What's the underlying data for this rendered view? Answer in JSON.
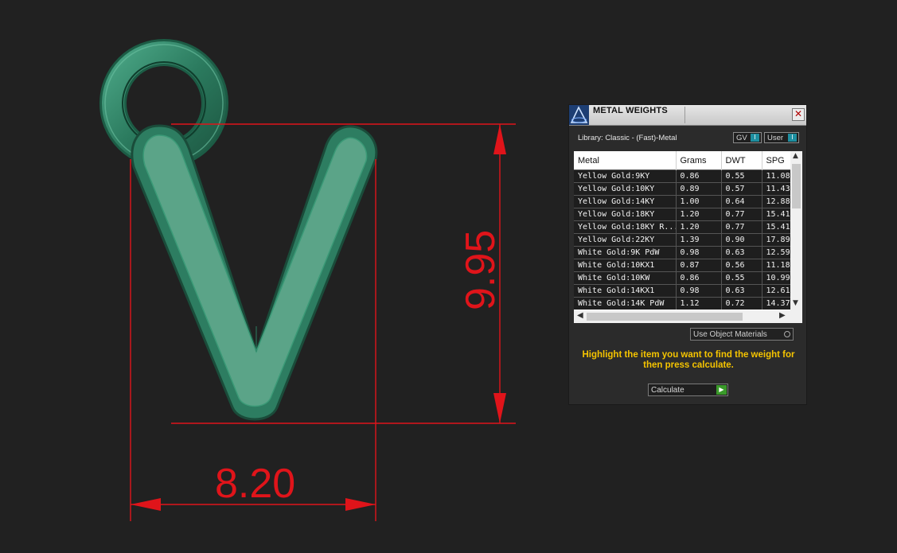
{
  "viewport": {
    "width_dimension": "8.20",
    "height_dimension": "9.95",
    "dimension_color": "#e0141a",
    "model_color": "#4fa083",
    "background": "#212121"
  },
  "panel": {
    "title": "METAL WEIGHTS",
    "close_glyph": "✕",
    "library_label": "Library: Classic - (Fast)-Metal",
    "toggles": {
      "gv": "GV",
      "user": "User",
      "knob": "I"
    },
    "table": {
      "columns": [
        "Metal",
        "Grams",
        "DWT",
        "SPG"
      ],
      "rows": [
        [
          "Yellow Gold:9KY",
          "0.86",
          "0.55",
          "11.08"
        ],
        [
          "Yellow Gold:10KY",
          "0.89",
          "0.57",
          "11.43"
        ],
        [
          "Yellow Gold:14KY",
          "1.00",
          "0.64",
          "12.88"
        ],
        [
          "Yellow Gold:18KY",
          "1.20",
          "0.77",
          "15.41"
        ],
        [
          "Yellow Gold:18KY R...",
          "1.20",
          "0.77",
          "15.41"
        ],
        [
          "Yellow Gold:22KY",
          "1.39",
          "0.90",
          "17.89"
        ],
        [
          "White Gold:9K PdW",
          "0.98",
          "0.63",
          "12.59"
        ],
        [
          "White Gold:10KX1",
          "0.87",
          "0.56",
          "11.18"
        ],
        [
          "White Gold:10KW",
          "0.86",
          "0.55",
          "10.99"
        ],
        [
          "White Gold:14KX1",
          "0.98",
          "0.63",
          "12.61"
        ],
        [
          "White Gold:14K PdW",
          "1.12",
          "0.72",
          "14.37"
        ]
      ]
    },
    "use_object_materials": "Use Object Materials",
    "instruction": "Highlight the item you want to find the weight for then press calculate.",
    "calculate_label": "Calculate",
    "accent_color": "#f5c400"
  }
}
